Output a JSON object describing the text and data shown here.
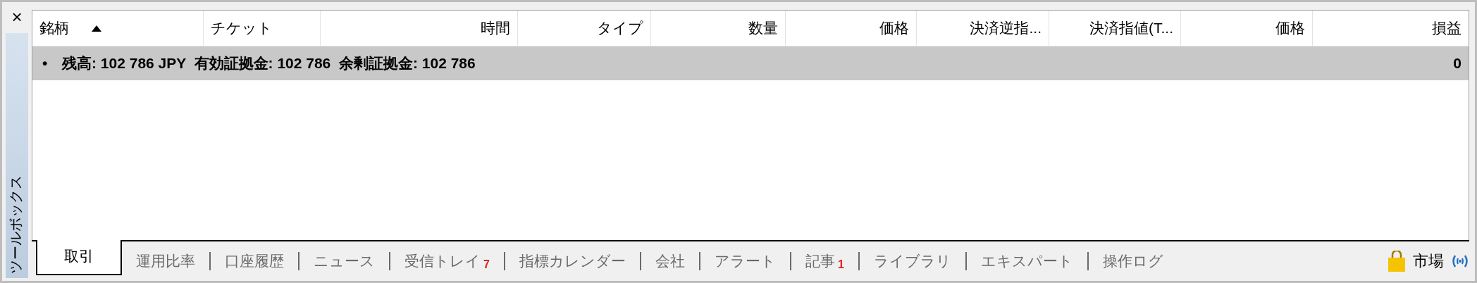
{
  "close_button": "×",
  "sidebar": {
    "title": "ツールボックス"
  },
  "table": {
    "columns": [
      {
        "label": "銘柄",
        "sorted": true
      },
      {
        "label": "チケット",
        "sorted": false
      },
      {
        "label": "時間",
        "sorted": false
      },
      {
        "label": "タイプ",
        "sorted": false
      },
      {
        "label": "数量",
        "sorted": false
      },
      {
        "label": "価格",
        "sorted": false
      },
      {
        "label": "決済逆指...",
        "sorted": false
      },
      {
        "label": "決済指値(T...",
        "sorted": false
      },
      {
        "label": "価格",
        "sorted": false
      },
      {
        "label": "損益",
        "sorted": false
      }
    ],
    "summary_row": {
      "bullet": "•",
      "text": "残高: 102 786 JPY  有効証拠金: 102 786  余剰証拠金: 102 786",
      "profit": "0"
    }
  },
  "tabs": [
    {
      "label": "取引",
      "selected": true
    },
    {
      "label": "運用比率",
      "selected": false
    },
    {
      "label": "口座履歴",
      "selected": false
    },
    {
      "label": "ニュース",
      "selected": false
    },
    {
      "label": "受信トレイ",
      "selected": false,
      "badge": "7"
    },
    {
      "label": "指標カレンダー",
      "selected": false
    },
    {
      "label": "会社",
      "selected": false
    },
    {
      "label": "アラート",
      "selected": false
    },
    {
      "label": "記事",
      "selected": false,
      "badge": "1"
    },
    {
      "label": "ライブラリ",
      "selected": false
    },
    {
      "label": "エキスパート",
      "selected": false
    },
    {
      "label": "操作ログ",
      "selected": false
    }
  ],
  "market": {
    "label": "市場"
  }
}
